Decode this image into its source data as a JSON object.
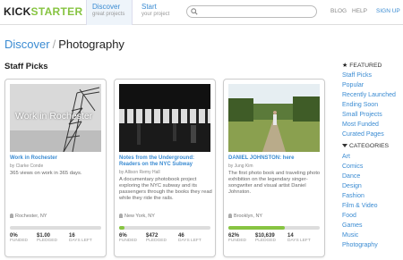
{
  "header": {
    "logo_kick": "KICK",
    "logo_starter": "STARTER",
    "discover_title": "Discover",
    "discover_sub": "great projects",
    "start_title": "Start",
    "start_sub": "your project",
    "search_placeholder": "",
    "blog": "BLOG",
    "help": "HELP",
    "signup": "SIGN UP"
  },
  "page": {
    "crumb": "Discover",
    "separator": "/",
    "current": "Photography",
    "section": "Staff Picks"
  },
  "cards": [
    {
      "thumb_text": "Work in Rochester",
      "title": "Work in Rochester",
      "by": "by Clarke Conde",
      "desc": "365 views on work in 365 days.",
      "location": "Rochester, NY",
      "funded_pct": 0,
      "funded": "0%",
      "pledged": "$1.00",
      "days": "16",
      "funded_label": "FUNDED",
      "pledged_label": "PLEDGED",
      "days_label": "DAYS LEFT"
    },
    {
      "thumb_text": "",
      "title": "Notes from the Underground: Readers on the NYC Subway",
      "by": "by Allison Remy Hall",
      "desc": "A documentary photobook project exploring the NYC subway and its passengers through the books they read while they ride the rails.",
      "location": "New York, NY",
      "funded_pct": 6,
      "funded": "6%",
      "pledged": "$472",
      "days": "46",
      "funded_label": "FUNDED",
      "pledged_label": "PLEDGED",
      "days_label": "DAYS LEFT"
    },
    {
      "thumb_text": "",
      "title": "DANIEL JOHNSTON: here",
      "by": "by Jung Kim",
      "desc": "The first photo book and traveling photo exhibition on the legendary singer-songwriter and visual artist Daniel Johnston.",
      "location": "Brooklyn, NY",
      "funded_pct": 62,
      "funded": "62%",
      "pledged": "$10,639",
      "days": "14",
      "funded_label": "FUNDED",
      "pledged_label": "PLEDGED",
      "days_label": "DAYS LEFT"
    }
  ],
  "sidebar": {
    "featured_heading": "FEATURED",
    "featured": [
      "Staff Picks",
      "Popular",
      "Recently Launched",
      "Ending Soon",
      "Small Projects",
      "Most Funded",
      "Curated Pages"
    ],
    "categories_heading": "CATEGORIES",
    "categories": [
      "Art",
      "Comics",
      "Dance",
      "Design",
      "Fashion",
      "Film & Video",
      "Food",
      "Games",
      "Music",
      "Photography"
    ]
  },
  "colors": {
    "accent_blue": "#3a8bd2",
    "brand_green": "#87c442"
  }
}
